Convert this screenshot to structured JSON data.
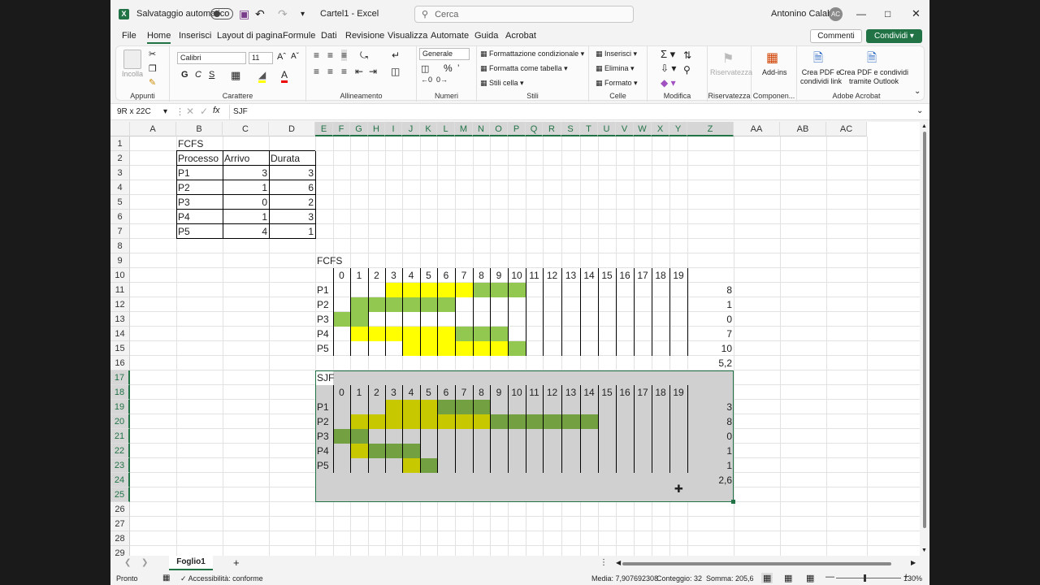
{
  "titlebar": {
    "autosave": "Salvataggio automatico",
    "doc": "Cartel1 - Excel",
    "search": "Cerca",
    "user": "Antonino Calabro",
    "initials": "AC"
  },
  "menu": [
    "File",
    "Home",
    "Inserisci",
    "Layout di pagina",
    "Formule",
    "Dati",
    "Revisione",
    "Visualizza",
    "Automate",
    "Guida",
    "Acrobat"
  ],
  "menu_buttons": {
    "comments": "Commenti",
    "share": "Condividi"
  },
  "ribbon": {
    "paste": "Incolla",
    "clipboard": "Appunti",
    "font": "Calibri",
    "size": "11",
    "font_group": "Carattere",
    "align_group": "Allineamento",
    "numfmt": "Generale",
    "numbers_group": "Numeri",
    "cond": "Formattazione condizionale",
    "table": "Formatta come tabella",
    "cellstyles": "Stili cella",
    "styles_group": "Stili",
    "insert": "Inserisci",
    "delete": "Elimina",
    "format": "Formato",
    "cells_group": "Celle",
    "edit_group": "Modifica",
    "privacy": "Riservatezza",
    "privacy_group": "Riservatezza",
    "addins": "Add-ins",
    "addins_group": "Componen...",
    "pdf1a": "Crea PDF e",
    "pdf1b": "condividi link",
    "pdf2a": "Crea PDF e condividi",
    "pdf2b": "tramite Outlook",
    "acrobat_group": "Adobe Acrobat"
  },
  "formula": {
    "namebox": "9R x 22C",
    "fx": "fx",
    "value": "SJF"
  },
  "columns": [
    "A",
    "B",
    "C",
    "D",
    "E",
    "F",
    "G",
    "H",
    "I",
    "J",
    "K",
    "L",
    "M",
    "N",
    "O",
    "P",
    "Q",
    "R",
    "S",
    "T",
    "U",
    "V",
    "W",
    "X",
    "Y",
    "Z",
    "AA",
    "AB",
    "AC"
  ],
  "rows": [
    "1",
    "2",
    "3",
    "4",
    "5",
    "6",
    "7",
    "8",
    "9",
    "10",
    "11",
    "12",
    "13",
    "14",
    "15",
    "16",
    "17",
    "18",
    "19",
    "20",
    "21",
    "22",
    "23",
    "24",
    "25",
    "26",
    "27",
    "28",
    "29"
  ],
  "table": {
    "title": "FCFS",
    "headers": [
      "Processo",
      "Arrivo",
      "Durata"
    ],
    "rows": [
      [
        "P1",
        "3",
        "3"
      ],
      [
        "P2",
        "1",
        "6"
      ],
      [
        "P3",
        "0",
        "2"
      ],
      [
        "P4",
        "1",
        "3"
      ],
      [
        "P5",
        "4",
        "1"
      ]
    ]
  },
  "fcfs": {
    "title": "FCFS",
    "ticks": [
      "0",
      "1",
      "2",
      "3",
      "4",
      "5",
      "6",
      "7",
      "8",
      "9",
      "10",
      "11",
      "12",
      "13",
      "14",
      "15",
      "16",
      "17",
      "18",
      "19"
    ],
    "procs": [
      "P1",
      "P2",
      "P3",
      "P4",
      "P5"
    ],
    "waits": [
      "8",
      "1",
      "0",
      "7",
      "10"
    ],
    "avg": "5,2"
  },
  "sjf": {
    "title": "SJF",
    "ticks": [
      "0",
      "1",
      "2",
      "3",
      "4",
      "5",
      "6",
      "7",
      "8",
      "9",
      "10",
      "11",
      "12",
      "13",
      "14",
      "15",
      "16",
      "17",
      "18",
      "19"
    ],
    "procs": [
      "P1",
      "P2",
      "P3",
      "P4",
      "P5"
    ],
    "waits": [
      "3",
      "8",
      "0",
      "1",
      "1"
    ],
    "avg": "2,6"
  },
  "gantt_fcfs": [
    [
      "wait",
      3,
      5
    ],
    [
      "run",
      8,
      3
    ],
    [
      "wait",
      1,
      6
    ],
    [
      "run",
      1,
      6
    ],
    [
      "run",
      0,
      2
    ],
    [
      "wait",
      1,
      6
    ],
    [
      "run",
      7,
      3
    ],
    [
      "wait",
      4,
      6
    ],
    [
      "run",
      10,
      1
    ]
  ],
  "gantt_sjf": [
    [
      "wait",
      3,
      3
    ],
    [
      "run",
      6,
      3
    ],
    [
      "wait",
      1,
      8
    ],
    [
      "run",
      9,
      6
    ],
    [
      "run",
      0,
      2
    ],
    [
      "wait",
      1,
      1
    ],
    [
      "run",
      2,
      3
    ],
    [
      "wait",
      4,
      1
    ],
    [
      "run",
      5,
      1
    ]
  ],
  "colors": {
    "wait": "#ffff00",
    "run": "#92c84f",
    "sel_wait": "#c8c800",
    "sel_run": "#73a040",
    "sel": "#d0d0d0",
    "accent": "#217346"
  },
  "sheet": {
    "tab": "Foglio1"
  },
  "status": {
    "ready": "Pronto",
    "access": "Accessibilità: conforme",
    "media": "Media: 7,907692308",
    "count": "Conteggio: 32",
    "sum": "Somma: 205,6",
    "zoom": "130%"
  }
}
